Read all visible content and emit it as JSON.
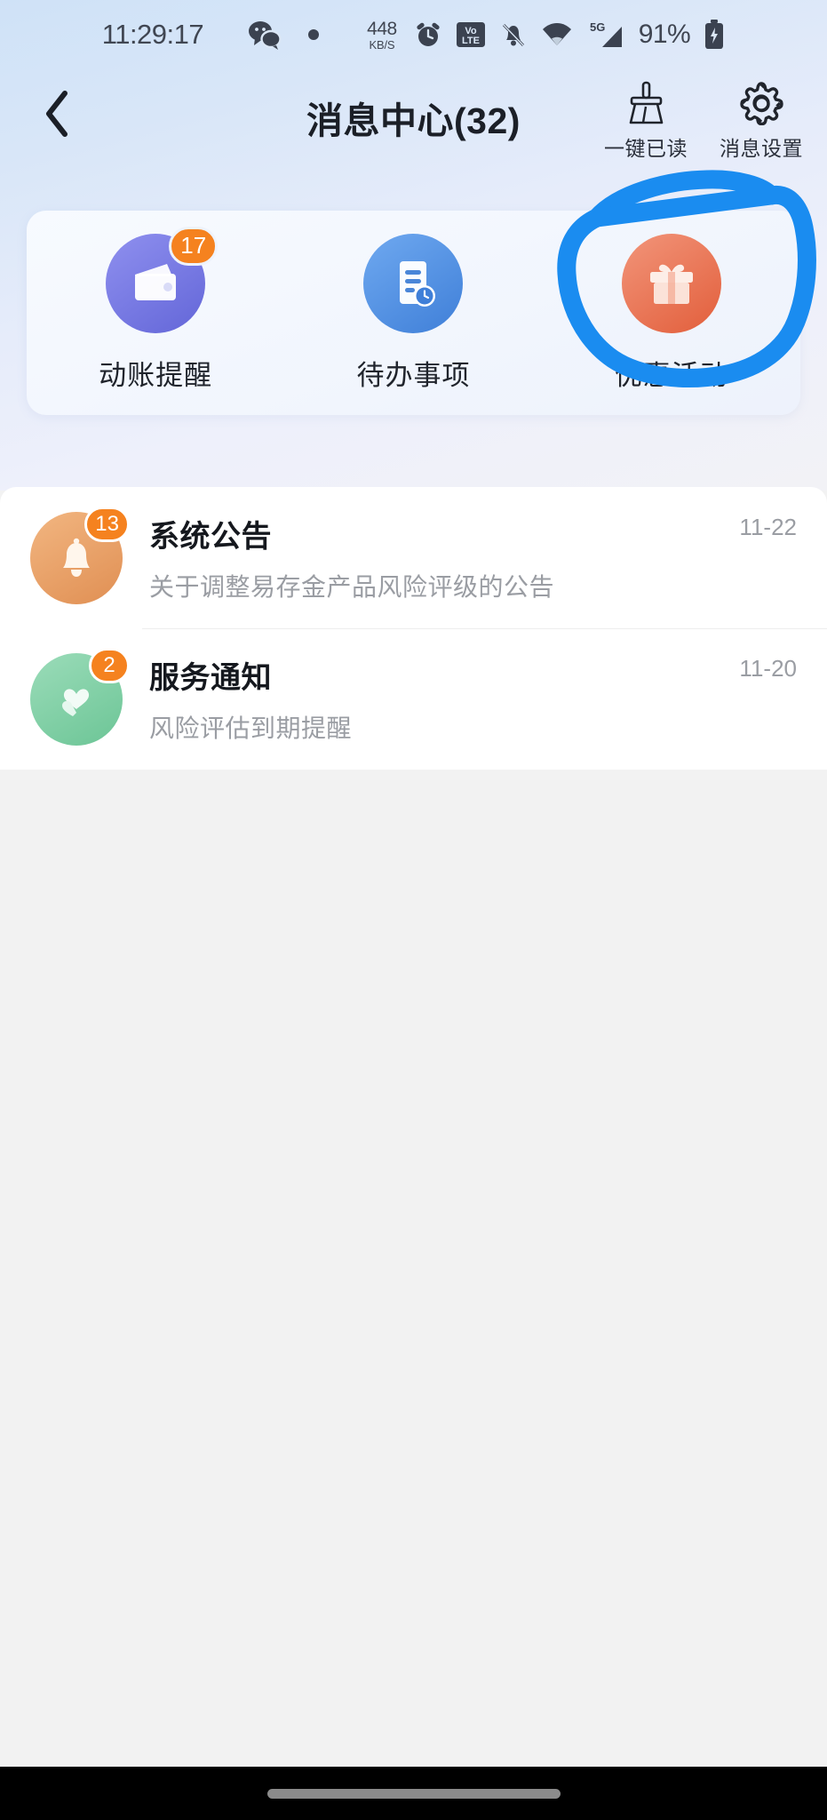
{
  "status_bar": {
    "time": "11:29:17",
    "net_speed_value": "448",
    "net_speed_unit": "KB/S",
    "battery_percent": "91%",
    "network_type": "5G",
    "icons": [
      "wechat-icon",
      "dot-icon",
      "alarm-icon",
      "volte-icon",
      "mute-bell-icon",
      "wifi-icon",
      "signal-icon",
      "battery-charging-icon"
    ]
  },
  "header": {
    "back_icon": "chevron-left-icon",
    "title": "消息中心(32)",
    "actions": [
      {
        "icon": "broom-icon",
        "label": "一键已读"
      },
      {
        "icon": "gear-icon",
        "label": "消息设置"
      }
    ]
  },
  "quick_access": [
    {
      "label": "动账提醒",
      "badge": "17",
      "icon": "wallet-icon",
      "color_from": "#8a8ced",
      "color_to": "#6366d8"
    },
    {
      "label": "待办事项",
      "badge": "",
      "icon": "document-clock-icon",
      "color_from": "#6aa7ef",
      "color_to": "#3f7fd8"
    },
    {
      "label": "优惠活动",
      "badge": "",
      "icon": "gift-icon",
      "color_from": "#f08a6b",
      "color_to": "#e4633f"
    }
  ],
  "messages": [
    {
      "title": "系统公告",
      "subtitle": "关于调整易存金产品风险评级的公告",
      "date": "11-22",
      "badge": "13",
      "icon": "bell-icon",
      "color_from": "#f0b07a",
      "color_to": "#e09258"
    },
    {
      "title": "服务通知",
      "subtitle": "风险评估到期提醒",
      "date": "11-20",
      "badge": "2",
      "icon": "heart-hands-icon",
      "color_from": "#92d7b3",
      "color_to": "#6fc79a"
    }
  ],
  "annotation": {
    "type": "hand-drawn-circle",
    "color": "#1a8cf0",
    "target": "优惠活动"
  },
  "colors": {
    "badge": "#f5821f",
    "accent": "#1a8cf0",
    "title": "#1b1f27",
    "muted": "#9a9da3",
    "page_bg": "#f2f2f2"
  },
  "gesture_bar": {
    "label": "home-indicator"
  }
}
